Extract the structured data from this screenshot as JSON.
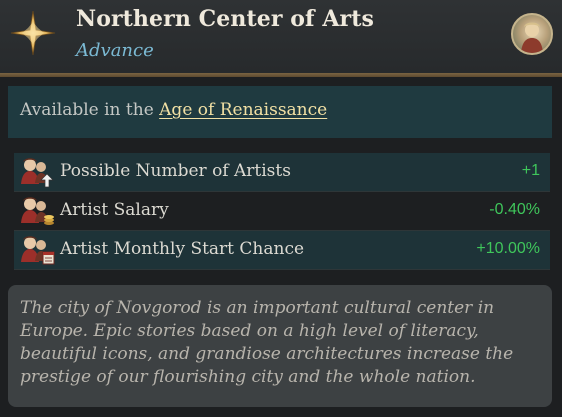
{
  "header": {
    "title": "Northern Center of Arts",
    "subtitle": "Advance",
    "emblem_icon": "compass-star-icon",
    "portrait_icon": "character-portrait"
  },
  "availability": {
    "prefix": "Available in the ",
    "age_link": "Age of Renaissance"
  },
  "modifiers": [
    {
      "label": "Possible Number of Artists",
      "value": "+1",
      "icon": "artist-count-icon"
    },
    {
      "label": "Artist Salary",
      "value": "-0.40%",
      "icon": "artist-salary-icon"
    },
    {
      "label": "Artist Monthly Start Chance",
      "value": "+10.00%",
      "icon": "artist-chance-icon"
    }
  ],
  "description": "The city of Novgorod is an important cultural center in Europe. Epic stories based on a high level of literacy, beautiful icons, and grandiose architectures increase the prestige of our flourishing city and the whole nation.",
  "colors": {
    "positive_value": "#3fc65b",
    "subtitle": "#7bbad4",
    "link": "#f1e0a4",
    "accent_rule": "#7a6442"
  }
}
